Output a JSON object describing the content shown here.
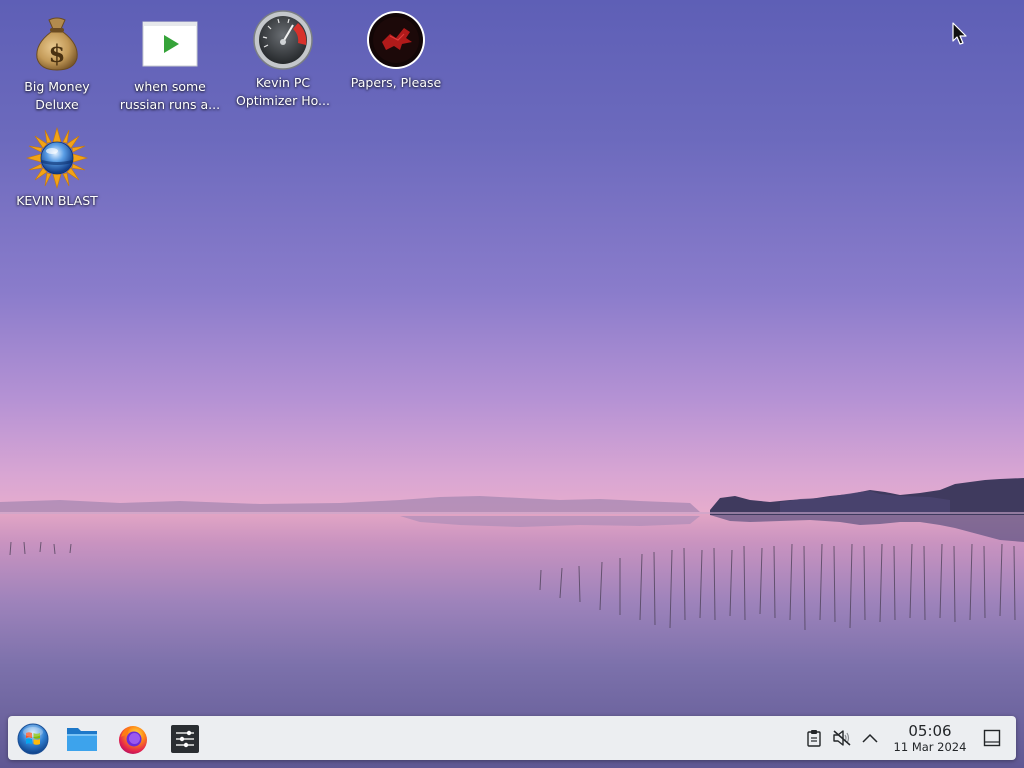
{
  "desktop": {
    "icons": [
      {
        "label": "Big Money\nDeluxe",
        "icon": "money-bag-icon"
      },
      {
        "label": "when some\nrussian runs a...",
        "icon": "video-play-icon"
      },
      {
        "label": "Kevin PC\nOptimizer Ho...",
        "icon": "speedometer-icon"
      },
      {
        "label": "Papers, Please",
        "icon": "papers-please-emblem-icon"
      },
      {
        "label": "KEVIN BLAST",
        "icon": "globe-sun-icon"
      }
    ]
  },
  "taskbar": {
    "launchers": [
      {
        "name": "start-menu-button",
        "icon": "windows-orb-icon"
      },
      {
        "name": "file-manager-button",
        "icon": "folder-icon"
      },
      {
        "name": "firefox-button",
        "icon": "firefox-icon"
      },
      {
        "name": "settings-button",
        "icon": "sliders-icon"
      }
    ],
    "tray": {
      "items": [
        "clipboard-icon",
        "volume-muted-icon",
        "chevron-up-icon"
      ],
      "clock": {
        "time": "05:06",
        "date": "11 Mar 2024"
      },
      "show_desktop": "show-desktop-icon"
    }
  }
}
